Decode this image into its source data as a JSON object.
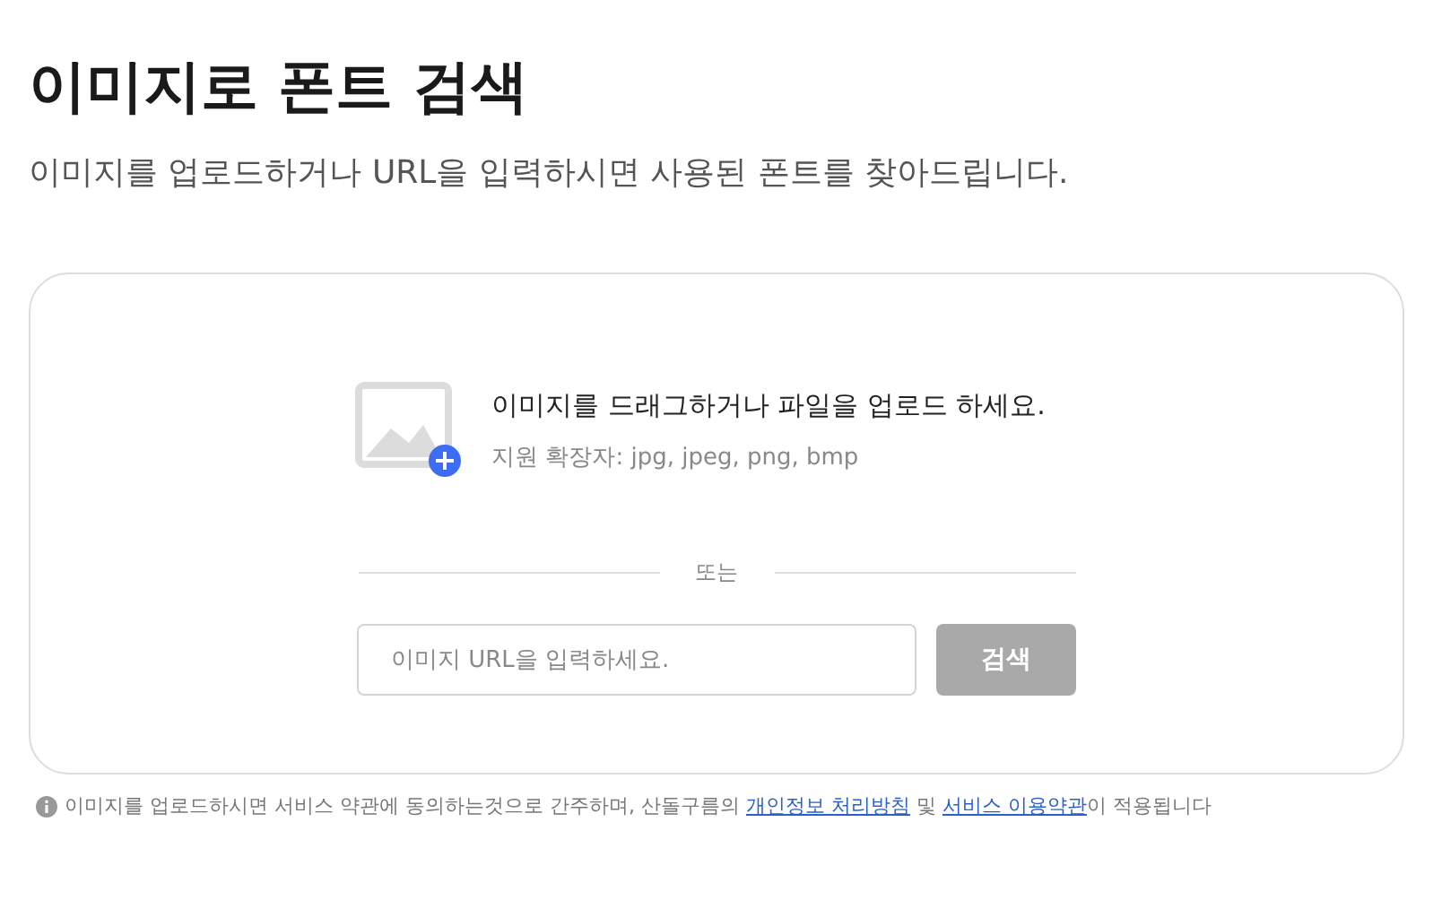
{
  "title": "이미지로 폰트 검색",
  "subtitle": "이미지를 업로드하거나 URL을 입력하시면 사용된 폰트를 찾아드립니다.",
  "upload": {
    "prompt": "이미지를 드래그하거나 파일을 업로드 하세요.",
    "formats": "지원 확장자: jpg, jpeg, png, bmp"
  },
  "divider_label": "또는",
  "url_field": {
    "placeholder": "이미지 URL을 입력하세요."
  },
  "search_button": {
    "label": "검색",
    "disabled": true
  },
  "notice": {
    "parts": [
      {
        "kind": "text",
        "text": "이미지를 업로드하시면 서비스 약관에 동의하는것으로 간주하며, 산돌구름의 "
      },
      {
        "kind": "link",
        "text": "개인정보 처리방침"
      },
      {
        "kind": "text",
        "text": " 및 "
      },
      {
        "kind": "link",
        "text": "서비스 이용약관"
      },
      {
        "kind": "text",
        "text": "이 적용됩니다"
      }
    ]
  }
}
